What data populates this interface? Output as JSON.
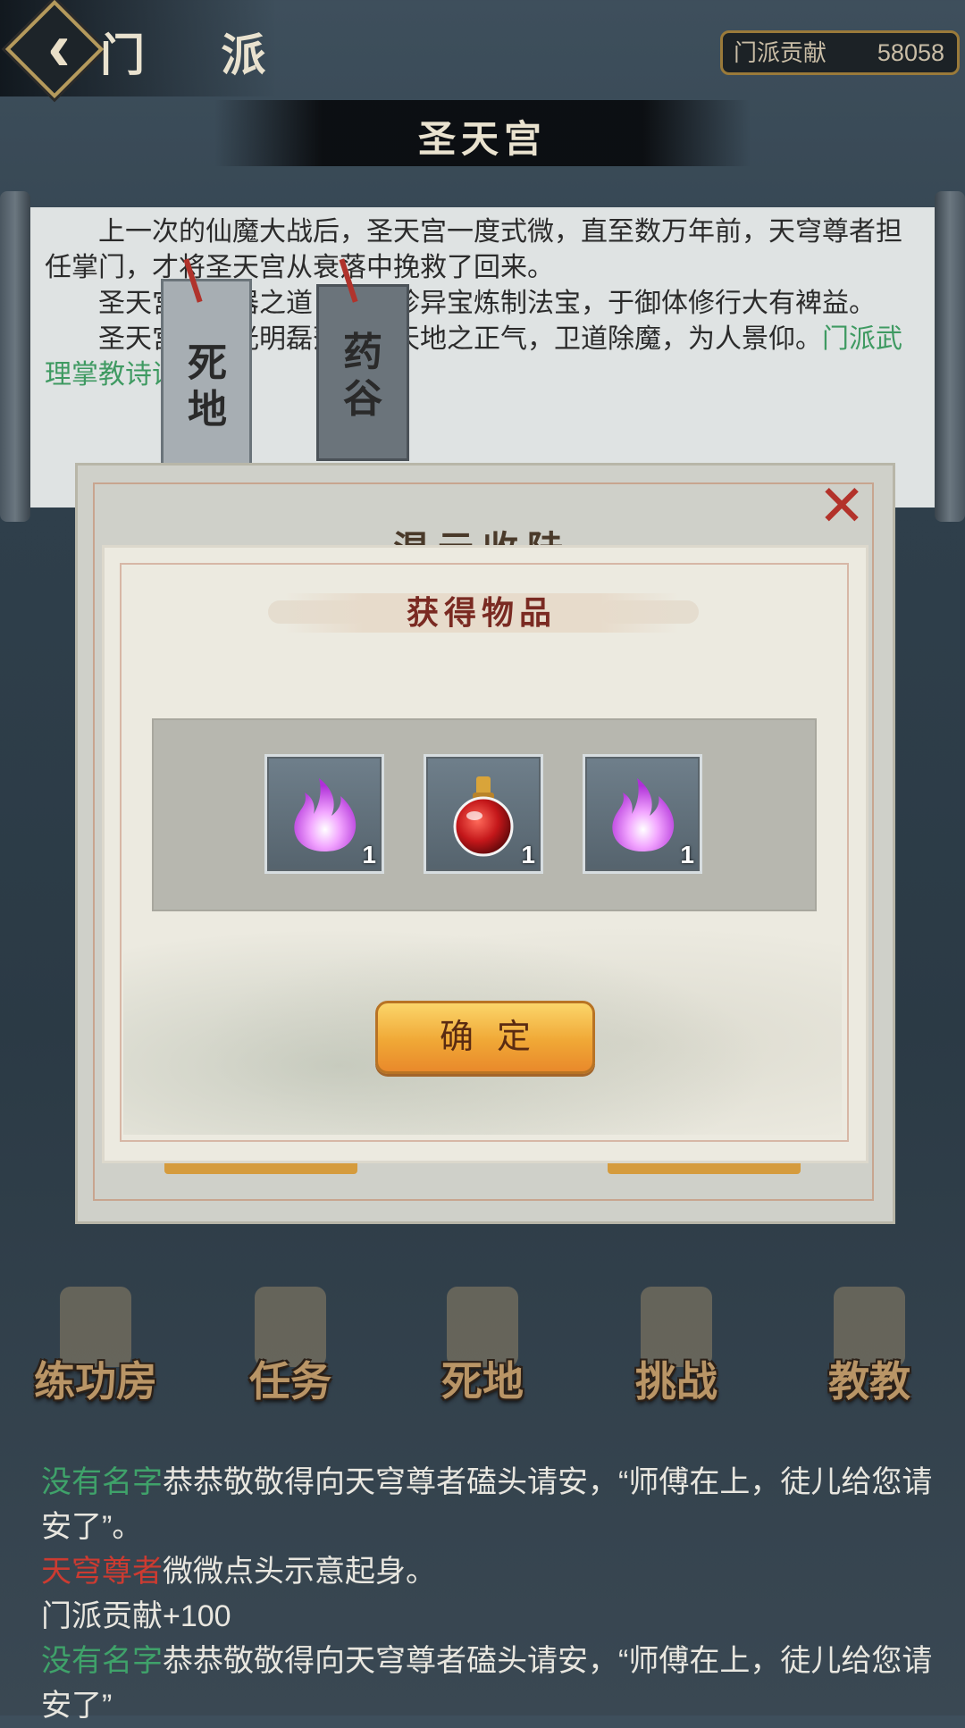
{
  "header": {
    "title": "门 派",
    "contribution_label": "门派贡献",
    "contribution_value": "58058",
    "sect_name": "圣天宫"
  },
  "lore": {
    "p1": "上一次的仙魔大战后，圣天宫一度式微，直至数万年前，天穹尊者担任掌门，才将圣天宫从衰落中挽救了回来。",
    "p2": "圣天宫擅炼器之道，采奇珍异宝炼制法宝，于御体修行大有裨益。",
    "p3_prefix": "圣天宫行事光明磊落，秉天地之正气，卫道除魔，为人景仰。",
    "p3_link": "门派武理掌教诗诗客。"
  },
  "tags": [
    "死地",
    "药谷"
  ],
  "outer_dialog": {
    "title": "混元收陆",
    "close_icon": "close-icon"
  },
  "popup": {
    "title": "获得物品",
    "items": [
      {
        "name": "purple-flame",
        "qty": "1"
      },
      {
        "name": "red-potion",
        "qty": "1"
      },
      {
        "name": "purple-flame",
        "qty": "1"
      }
    ],
    "confirm_label": "确定"
  },
  "nav": [
    "练功房",
    "任务",
    "死地",
    "挑战",
    "教教"
  ],
  "log": {
    "l1_name": "没有名字",
    "l1_text": "恭恭敬敬得向天穹尊者磕头请安，“师傅在上，徒儿给您请安了”。",
    "l2_name": "天穹尊者",
    "l2_text": "微微点头示意起身。",
    "l3_text": "门派贡献+100",
    "l4_name": "没有名字",
    "l4_text": "恭恭敬敬得向天穹尊者磕头请安，“师傅在上，徒儿给您请安了”"
  },
  "colors": {
    "accent_gold": "#f0a836",
    "title_red": "#7a2a22",
    "link_green": "#3fa26a",
    "name_red": "#cc3b31"
  }
}
